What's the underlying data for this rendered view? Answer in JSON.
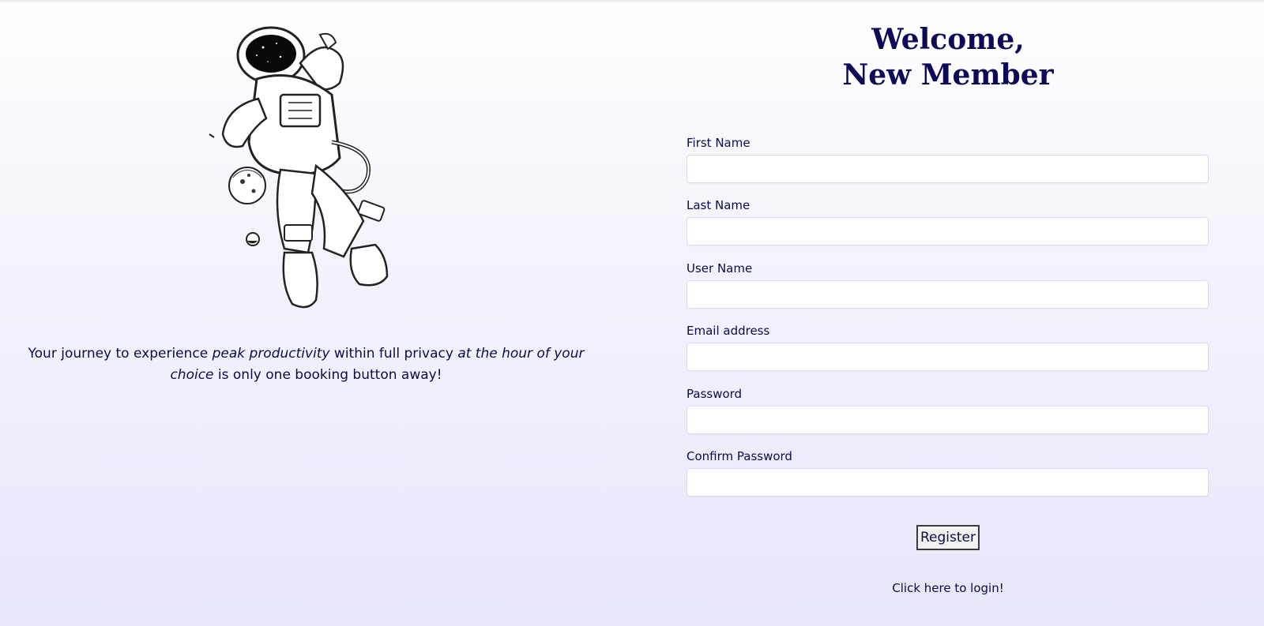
{
  "hero": {
    "tagline": {
      "part1": "Your journey to experience ",
      "emphasis1": "peak productivity",
      "part2": " within full privacy ",
      "emphasis2": "at the hour of your choice",
      "part3": " is only one booking button away!"
    },
    "illustration_icon": "astronaut-illustration"
  },
  "form": {
    "title_line1": "Welcome,",
    "title_line2": "New Member",
    "fields": [
      {
        "label": "First Name",
        "value": "",
        "placeholder": ""
      },
      {
        "label": "Last Name",
        "value": "",
        "placeholder": ""
      },
      {
        "label": "User Name",
        "value": "",
        "placeholder": ""
      },
      {
        "label": "Email address",
        "value": "",
        "placeholder": ""
      },
      {
        "label": "Password",
        "value": "",
        "placeholder": ""
      },
      {
        "label": "Confirm Password",
        "value": "",
        "placeholder": ""
      }
    ],
    "register_label": "Register",
    "login_link": "Click here to login!"
  },
  "colors": {
    "text": "#0b0b4a",
    "heading": "#0d0a57",
    "background_bottom": "#e8e7fb"
  }
}
